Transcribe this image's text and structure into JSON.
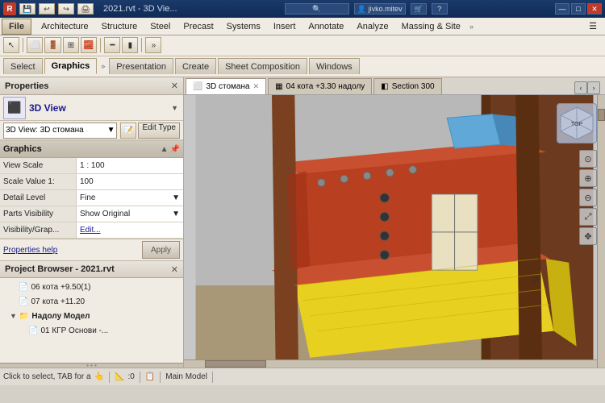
{
  "titlebar": {
    "title": "2021.rvt - 3D Vie...",
    "icon": "R",
    "controls": [
      "—",
      "□",
      "✕"
    ]
  },
  "menubar": {
    "file": "File",
    "items": [
      "Architecture",
      "Structure",
      "Steel",
      "Precast",
      "Systems",
      "Insert",
      "Annotate",
      "Analyze",
      "Massing & Site",
      "»",
      "☰"
    ]
  },
  "toolbar": {
    "row2_tabs": [
      "Select",
      "Graphics",
      "»",
      "Presentation",
      "Create",
      "Sheet Composition",
      "Windows"
    ]
  },
  "properties": {
    "title": "Properties",
    "close": "✕",
    "view_type": "3D View",
    "view_name": "3D View: 3D стомана",
    "edit_type_btn": "Edit Type",
    "sections": [
      {
        "name": "Graphics",
        "props": [
          {
            "label": "View Scale",
            "value": "1 : 100"
          },
          {
            "label": "Scale Value  1:",
            "value": "100"
          },
          {
            "label": "Detail Level",
            "value": "Fine"
          },
          {
            "label": "Parts Visibility",
            "value": "Show Original"
          },
          {
            "label": "Visibility/Grap...",
            "value": "Edit..."
          }
        ]
      }
    ],
    "help_link": "Properties help",
    "apply_btn": "Apply"
  },
  "project_browser": {
    "title": "Project Browser - 2021.rvt",
    "close": "✕",
    "items": [
      {
        "label": "06 кота +9.50(1)",
        "indent": 2
      },
      {
        "label": "07 кота +11.20",
        "indent": 2
      },
      {
        "label": "Надолу Модел",
        "indent": 1,
        "expanded": true,
        "icon": "▼"
      },
      {
        "label": "01 КГР Основи -...",
        "indent": 2
      }
    ]
  },
  "view_tabs": [
    {
      "label": "3D стомана",
      "icon": "⬜",
      "active": true,
      "closeable": true
    },
    {
      "label": "04 кота +3.30 надолу",
      "icon": "▦",
      "active": false,
      "closeable": false
    },
    {
      "label": "Section 300",
      "icon": "◧",
      "active": false,
      "closeable": false
    }
  ],
  "nav_cube": {
    "face": "TOP"
  },
  "nav_controls": [
    "⊙",
    "⊕",
    "⊖",
    "⤢"
  ],
  "status_bar": {
    "text": "Click to select, TAB for a",
    "icon": "👆",
    "zoom_value": ":0",
    "model": "Main Model"
  },
  "colors": {
    "accent_blue": "#1a3a6b",
    "panel_bg": "#f0ece4",
    "border": "#b0a898",
    "selected_tab": "#ffffff",
    "viewport_bg": "#b8b8b8"
  }
}
